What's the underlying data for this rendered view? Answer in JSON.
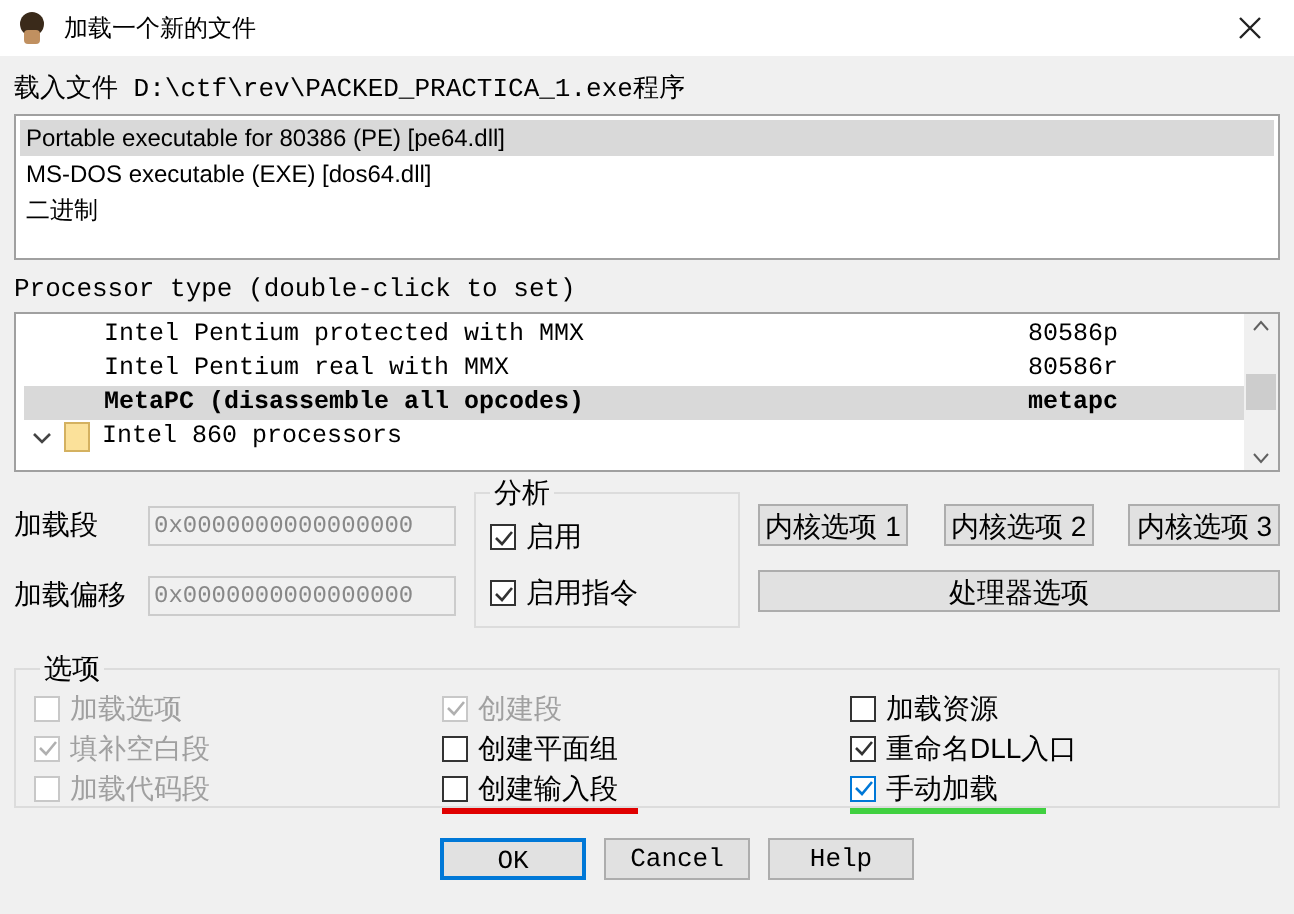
{
  "window": {
    "title": "加载一个新的文件"
  },
  "file_label": "载入文件 D:\\ctf\\rev\\PACKED_PRACTICA_1.exe程序",
  "loaders": [
    {
      "label": "Portable executable for 80386 (PE) [pe64.dll]",
      "selected": true
    },
    {
      "label": "MS-DOS executable (EXE) [dos64.dll]",
      "selected": false
    },
    {
      "label": "二进制",
      "selected": false
    }
  ],
  "processor_label": "Processor type (double-click to set)",
  "processors": [
    {
      "kind": "item",
      "name": "Intel Pentium protected with MMX",
      "code": "80586p",
      "selected": false
    },
    {
      "kind": "item",
      "name": "Intel Pentium real with MMX",
      "code": "80586r",
      "selected": false
    },
    {
      "kind": "item",
      "name": "MetaPC (disassemble all opcodes)",
      "code": "metapc",
      "selected": true
    },
    {
      "kind": "folder",
      "name": "Intel 860 processors",
      "expanded": true
    }
  ],
  "fields": [
    {
      "label": "加载段",
      "value": "0x0000000000000000"
    },
    {
      "label": "加载偏移",
      "value": "0x0000000000000000"
    }
  ],
  "analysis": {
    "title": "分析",
    "options": [
      {
        "label": "启用",
        "checked": true
      },
      {
        "label": "启用指令",
        "checked": true
      }
    ]
  },
  "kernel_buttons": [
    "内核选项 1",
    "内核选项 2",
    "内核选项 3"
  ],
  "processor_button": "处理器选项",
  "options": {
    "title": "选项",
    "columns": [
      [
        {
          "label": "加载选项",
          "checked": false,
          "disabled": true
        },
        {
          "label": "填补空白段",
          "checked": true,
          "disabled": true
        },
        {
          "label": "加载代码段",
          "checked": false,
          "disabled": true
        }
      ],
      [
        {
          "label": "创建段",
          "checked": true,
          "disabled": true
        },
        {
          "label": "创建平面组",
          "checked": false,
          "disabled": false
        },
        {
          "label": "创建输入段",
          "checked": false,
          "disabled": false,
          "color": "#e00000"
        }
      ],
      [
        {
          "label": "加载资源",
          "checked": false,
          "disabled": false
        },
        {
          "label": "重命名DLL入口",
          "checked": true,
          "disabled": false
        },
        {
          "label": "手动加载",
          "checked": true,
          "disabled": false,
          "focused": true,
          "color": "#40d040"
        }
      ]
    ]
  },
  "buttons": [
    {
      "label": "OK",
      "default": true
    },
    {
      "label": "Cancel",
      "default": false
    },
    {
      "label": "Help",
      "default": false
    }
  ]
}
